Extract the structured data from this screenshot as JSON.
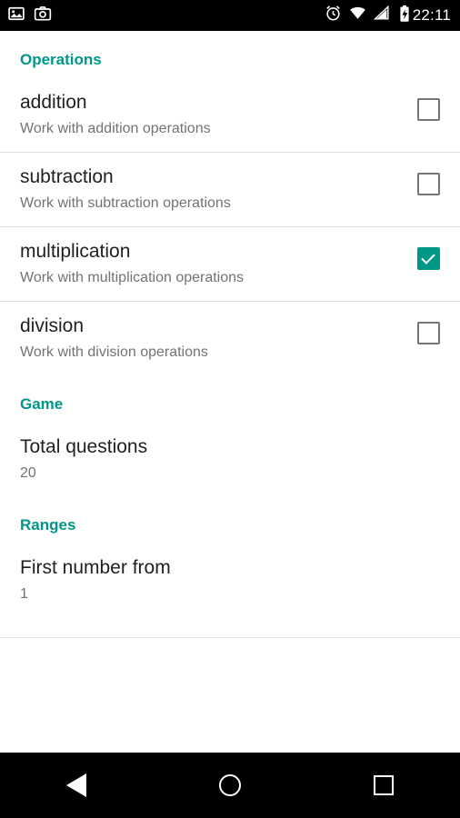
{
  "statusbar": {
    "time": "22:11",
    "left_icons": [
      "image-icon",
      "camera-icon"
    ],
    "right_icons": [
      "alarm-icon",
      "wifi-icon",
      "signal-icon",
      "battery-charging-icon"
    ]
  },
  "sections": [
    {
      "id": "operations",
      "header": "Operations",
      "items": [
        {
          "title": "addition",
          "summary": "Work with addition operations",
          "checked": false,
          "name": "pref-addition"
        },
        {
          "title": "subtraction",
          "summary": "Work with subtraction operations",
          "checked": false,
          "name": "pref-subtraction"
        },
        {
          "title": "multiplication",
          "summary": "Work with multiplication operations",
          "checked": true,
          "name": "pref-multiplication"
        },
        {
          "title": "division",
          "summary": "Work with division operations",
          "checked": false,
          "name": "pref-division"
        }
      ]
    },
    {
      "id": "game",
      "header": "Game",
      "items": [
        {
          "title": "Total questions",
          "summary": "20",
          "name": "pref-total-questions"
        }
      ]
    },
    {
      "id": "ranges",
      "header": "Ranges",
      "items": [
        {
          "title": "First number from",
          "summary": "1",
          "name": "pref-first-number-from"
        }
      ]
    }
  ],
  "navbar": {
    "back_label": "Back",
    "home_label": "Home",
    "recents_label": "Recents"
  },
  "colors": {
    "accent": "#009688",
    "title_text": "#212121",
    "summary_text": "#737373",
    "divider": "#e0e0e0",
    "system_bar": "#000000"
  }
}
